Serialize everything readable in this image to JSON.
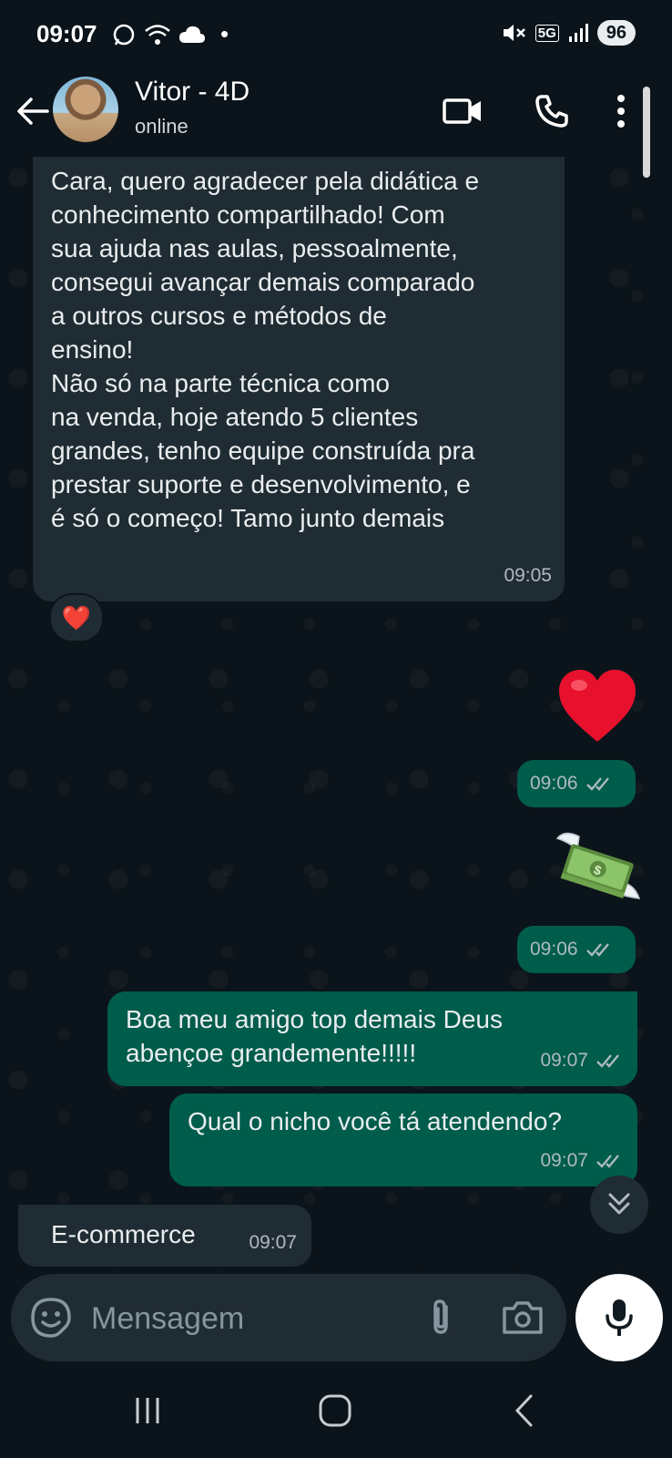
{
  "status_bar": {
    "time": "09:07",
    "battery": "96",
    "network": "5G"
  },
  "header": {
    "contact_name": "Vitor - 4D",
    "contact_status": "online"
  },
  "messages": [
    {
      "direction": "incoming",
      "text": "Cara, quero agradecer pela didática e\nconhecimento compartilhado! Com\nsua ajuda nas aulas, pessoalmente,\nconsegui avançar demais comparado\na outros cursos e métodos de\nensino!\nNão só na parte técnica como\nna venda, hoje atendo 5 clientes\ngrandes, tenho equipe construída pra\nprestar suporte e desenvolvimento, e\né só o começo! Tamo junto demais",
      "time": "09:05",
      "reaction": "❤️"
    },
    {
      "direction": "outgoing",
      "sticker": "heart-emoji",
      "time": "09:06"
    },
    {
      "direction": "outgoing",
      "sticker": "money-with-wings-emoji",
      "time": "09:06"
    },
    {
      "direction": "outgoing",
      "text": "Boa meu amigo top demais Deus\nabençoe grandemente!!!!!",
      "time": "09:07"
    },
    {
      "direction": "outgoing",
      "text": "Qual o nicho você tá atendendo?",
      "time": "09:07"
    },
    {
      "direction": "incoming",
      "text": "E-commerce",
      "time": "09:07"
    }
  ],
  "composer": {
    "placeholder": "Mensagem"
  },
  "colors": {
    "background": "#0b141a",
    "incoming_bubble": "#202c33",
    "outgoing_bubble": "#005c4b",
    "read_ticks": "#aebac1"
  }
}
